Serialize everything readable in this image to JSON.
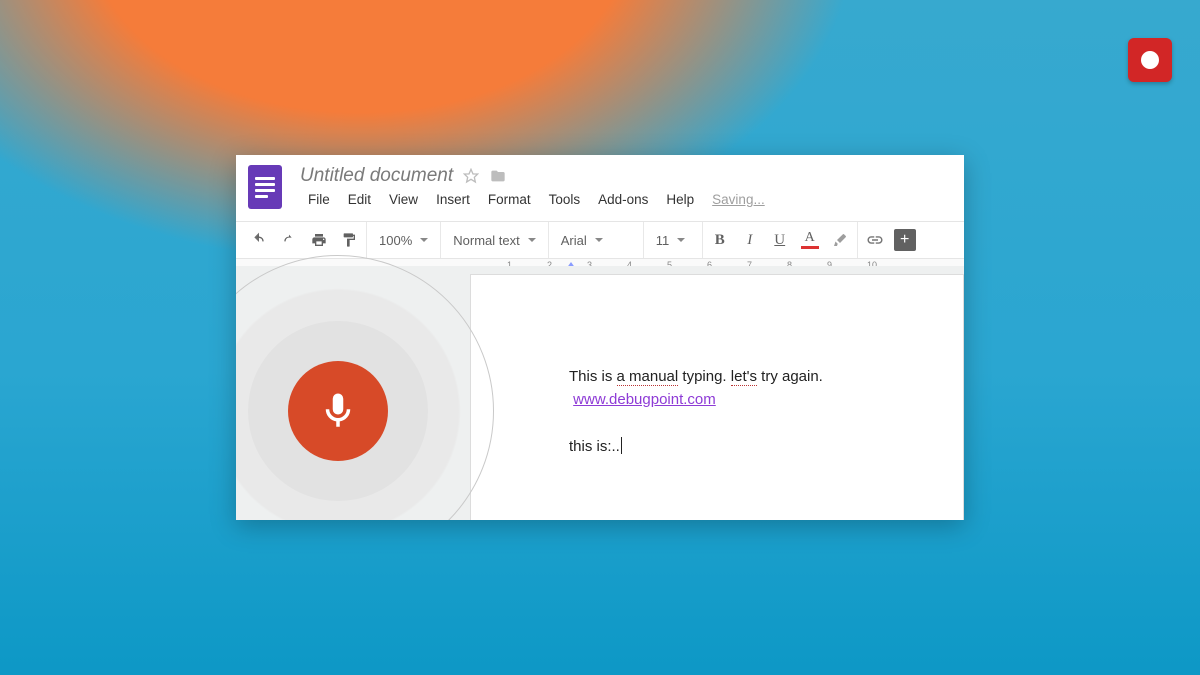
{
  "header": {
    "title": "Untitled document",
    "menus": [
      "File",
      "Edit",
      "View",
      "Insert",
      "Format",
      "Tools",
      "Add-ons",
      "Help"
    ],
    "status": "Saving..."
  },
  "toolbar": {
    "zoom": "100%",
    "style": "Normal text",
    "font": "Arial",
    "size": "11"
  },
  "ruler": {
    "numbers": [
      "",
      "1",
      "2",
      "3",
      "4",
      "5",
      "6",
      "7",
      "8",
      "9",
      "10"
    ]
  },
  "document": {
    "line1_a": "This is ",
    "line1_b": "a manual",
    "line1_c": " typing.  ",
    "line1_d": "let's",
    "line1_e": " try again.",
    "link": "www.debugpoint.com",
    "line3": "this is:.."
  },
  "icons": {
    "star": "star-icon",
    "folder": "folder-icon",
    "undo": "undo-icon",
    "redo": "redo-icon",
    "print": "print-icon",
    "paint": "paint-format-icon",
    "bold": "B",
    "italic": "I",
    "underline": "U",
    "textcolor": "A",
    "more": "+"
  }
}
